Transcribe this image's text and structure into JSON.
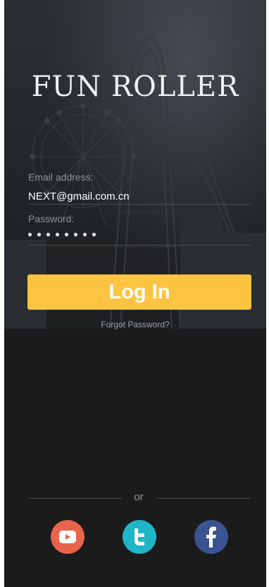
{
  "app": {
    "title": "FUN ROLLER"
  },
  "login": {
    "email_label": "Email address:",
    "email_value": "NEXT@gmail.com.cn",
    "password_label": "Password:",
    "password_masked": "••••••••",
    "button_label": "Log In",
    "forgot_label": "Forgot Password?"
  },
  "divider": {
    "or_label": "or"
  },
  "social": [
    {
      "name": "youtube-icon",
      "color": "#e8644c"
    },
    {
      "name": "twitter-icon",
      "color": "#1fb6c7"
    },
    {
      "name": "facebook-icon",
      "color": "#3a5491"
    }
  ],
  "colors": {
    "accent": "#fcc440",
    "background": "#1b1b1c"
  }
}
